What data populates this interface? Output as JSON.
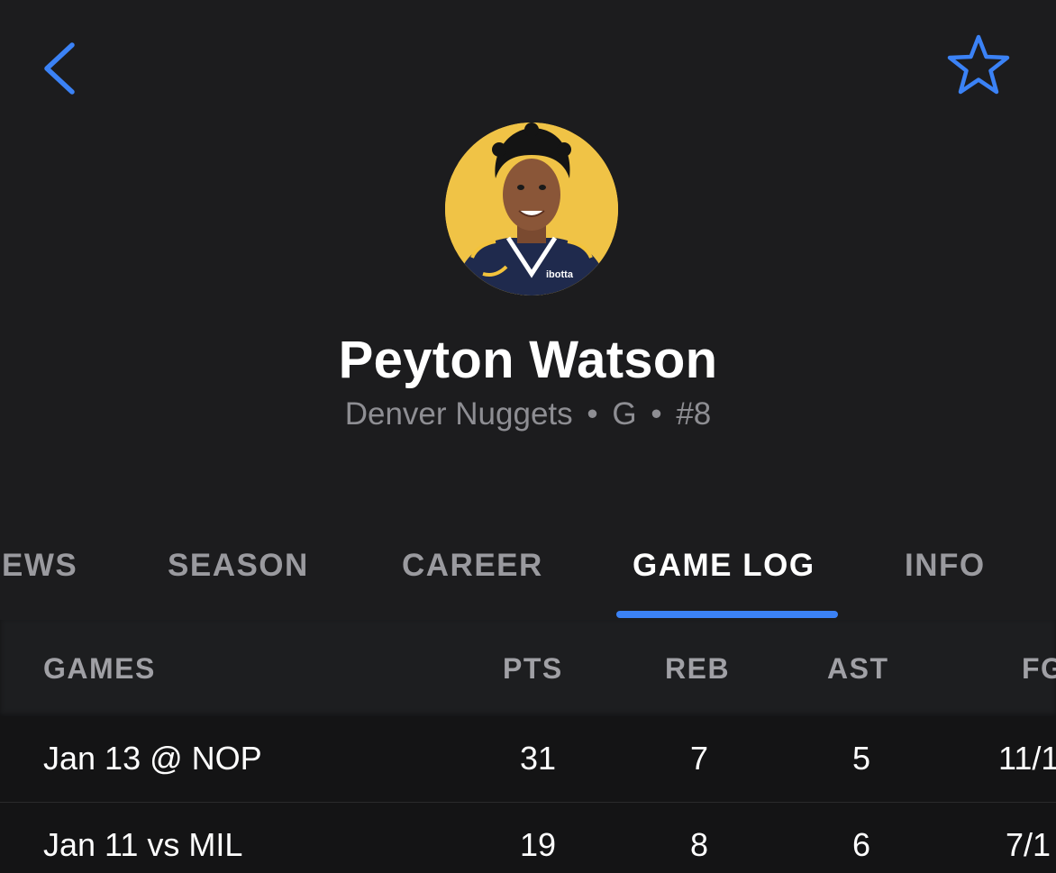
{
  "header": {
    "back_icon": "chevron-left-icon",
    "favorite_icon": "star-outline-icon",
    "accent_color": "#3b82f6"
  },
  "player": {
    "name": "Peyton Watson",
    "team": "Denver Nuggets",
    "position": "G",
    "number": "#8",
    "separator": "•",
    "avatar_background": "#f0c346",
    "jersey_text": "ibotta"
  },
  "tabs": [
    {
      "label": "EWS",
      "active": false
    },
    {
      "label": "SEASON",
      "active": false
    },
    {
      "label": "CAREER",
      "active": false
    },
    {
      "label": "GAME LOG",
      "active": true
    },
    {
      "label": "INFO",
      "active": false
    }
  ],
  "game_log": {
    "columns": [
      "GAMES",
      "PTS",
      "REB",
      "AST",
      "FG"
    ],
    "rows": [
      {
        "game": "Jan 13 @ NOP",
        "pts": "31",
        "reb": "7",
        "ast": "5",
        "fg": "11/1"
      },
      {
        "game": "Jan 11 vs MIL",
        "pts": "19",
        "reb": "8",
        "ast": "6",
        "fg": "7/1"
      }
    ]
  }
}
